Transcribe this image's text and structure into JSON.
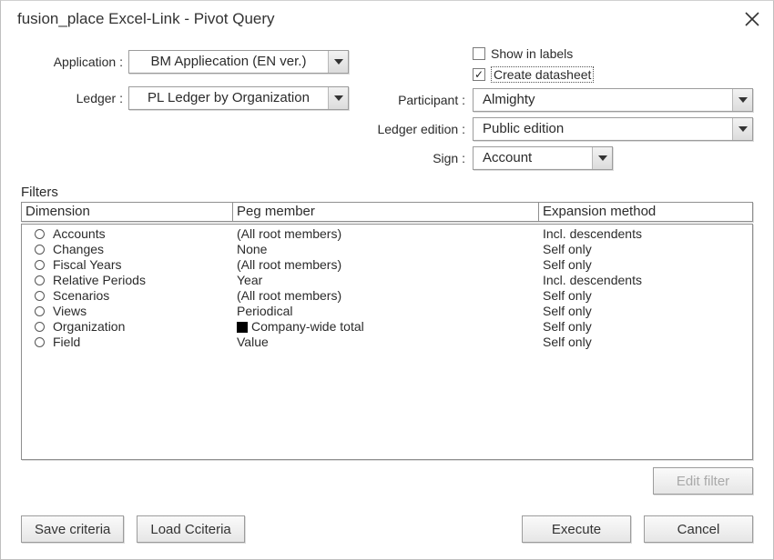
{
  "window": {
    "title": "fusion_place Excel-Link - Pivot Query"
  },
  "labels": {
    "application": "Application :",
    "ledger": "Ledger :",
    "participant": "Participant :",
    "ledger_edition": "Ledger edition :",
    "sign": "Sign :",
    "filters": "Filters"
  },
  "top": {
    "application": "BM Appliecation (EN ver.)",
    "ledger": "PL Ledger by Organization",
    "show_in_labels": "Show in labels",
    "create_datasheet": "Create datasheet",
    "participant": "Almighty",
    "ledger_edition": "Public edition",
    "sign": "Account"
  },
  "cols": {
    "dimension": "Dimension",
    "peg": "Peg member",
    "expansion": "Expansion method"
  },
  "rows": [
    {
      "dim": "Accounts",
      "peg": "(All root members)",
      "exp": "Incl. descendents",
      "black": false
    },
    {
      "dim": "Changes",
      "peg": "None",
      "exp": "Self only",
      "black": false
    },
    {
      "dim": "Fiscal Years",
      "peg": "(All root members)",
      "exp": "Self only",
      "black": false
    },
    {
      "dim": "Relative Periods",
      "peg": "Year",
      "exp": "Incl. descendents",
      "black": false
    },
    {
      "dim": "Scenarios",
      "peg": "(All root members)",
      "exp": "Self only",
      "black": false
    },
    {
      "dim": "Views",
      "peg": "Periodical",
      "exp": "Self only",
      "black": false
    },
    {
      "dim": "Organization",
      "peg": "Company-wide total",
      "exp": "Self only",
      "black": true
    },
    {
      "dim": "Field",
      "peg": "Value",
      "exp": "Self only",
      "black": false
    }
  ],
  "buttons": {
    "edit_filter": "Edit filter",
    "save": "Save criteria",
    "load": "Load Cciteria",
    "execute": "Execute",
    "cancel": "Cancel"
  }
}
